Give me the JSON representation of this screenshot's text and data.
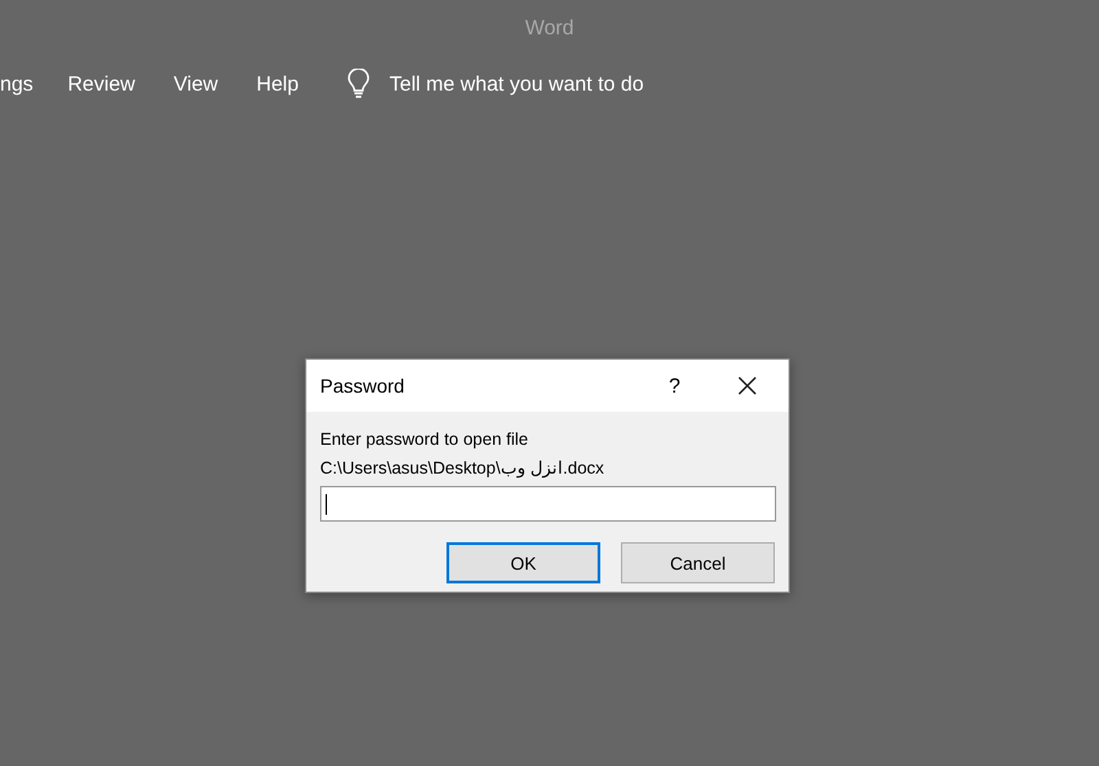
{
  "window": {
    "title": "Word"
  },
  "ribbon_tabs": [
    {
      "label": "ngs"
    },
    {
      "label": "Review"
    },
    {
      "label": "View"
    },
    {
      "label": "Help"
    }
  ],
  "tell_me": {
    "text": "Tell me what you want to do"
  },
  "dialog": {
    "title": "Password",
    "help": "?",
    "prompt": "Enter password to open file",
    "path": "C:\\Users\\asus\\Desktop\\انزل وب.docx",
    "password_field": {
      "focused": true
    },
    "buttons": [
      {
        "label": "OK",
        "default": true
      },
      {
        "label": "Cancel",
        "default": false
      }
    ]
  }
}
